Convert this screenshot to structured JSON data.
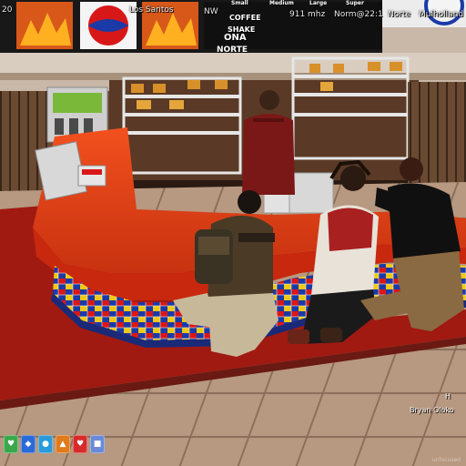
{
  "hud": {
    "year_prefix": "20",
    "city": "Los Santos",
    "compass": "NW",
    "coffee_label": "COFFEE",
    "shake_label": "SHAKE",
    "frequency": "911 mhz",
    "player_status": "Norm@22:1",
    "zone": "Norte",
    "location": "Mulholland",
    "menu_sizes": [
      "Small",
      "Medium",
      "Large",
      "Super"
    ],
    "logo_line1": "ONA",
    "logo_line2": "NORTE",
    "player_name": "Bryan Oloko",
    "player_marker": "H",
    "watermark": "unfocused"
  },
  "colors": {
    "counter_red": "#e8401a",
    "tile_blue": "#1a3aa8",
    "tile_yellow": "#f0c818",
    "tile_red": "#d81818",
    "floor_tile": "#b89a80",
    "shirt_maroon": "#7a1818",
    "tank_top": "#a82020"
  },
  "status_icons": [
    {
      "name": "health-icon",
      "color": "#3aa84a",
      "glyph": "♥"
    },
    {
      "name": "water-icon",
      "color": "#2a6ad8",
      "glyph": "◆"
    },
    {
      "name": "drop-icon",
      "color": "#2a9ad8",
      "glyph": "●"
    },
    {
      "name": "food-icon",
      "color": "#e07a1a",
      "glyph": "▲"
    },
    {
      "name": "heart-icon",
      "color": "#d82a2a",
      "glyph": "♥"
    },
    {
      "name": "shield-icon",
      "color": "#6a8ad8",
      "glyph": "■"
    }
  ]
}
